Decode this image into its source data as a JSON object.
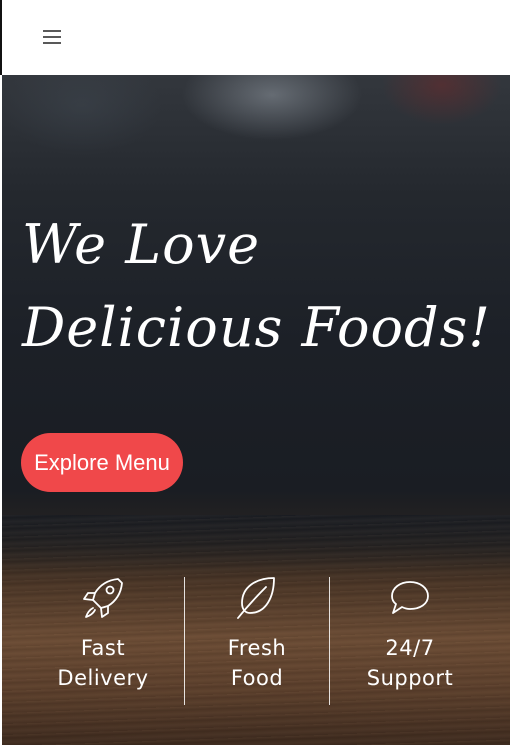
{
  "nav": {
    "menu_icon": "hamburger-menu-icon"
  },
  "hero": {
    "title_line1": "We Love",
    "title_line2": "Delicious Foods!",
    "cta_label": "Explore Menu",
    "cta_color": "#f0484a"
  },
  "features": [
    {
      "icon": "rocket-icon",
      "line1": "Fast",
      "line2": "Delivery"
    },
    {
      "icon": "leaf-icon",
      "line1": "Fresh",
      "line2": "Food"
    },
    {
      "icon": "speech-bubble-icon",
      "line1": "24/7",
      "line2": "Support"
    }
  ]
}
